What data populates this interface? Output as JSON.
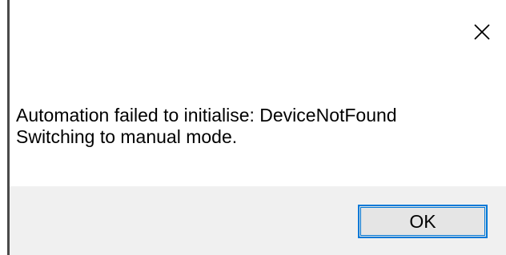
{
  "dialog": {
    "message_line_1": "Automation failed to initialise: DeviceNotFound",
    "message_line_2": "Switching to manual mode.",
    "close_icon": "close-icon",
    "ok_label": "OK"
  },
  "colors": {
    "background": "#ffffff",
    "footer_background": "#f0f0f0",
    "button_border": "#0078d7",
    "button_background": "#e5e5e5"
  }
}
